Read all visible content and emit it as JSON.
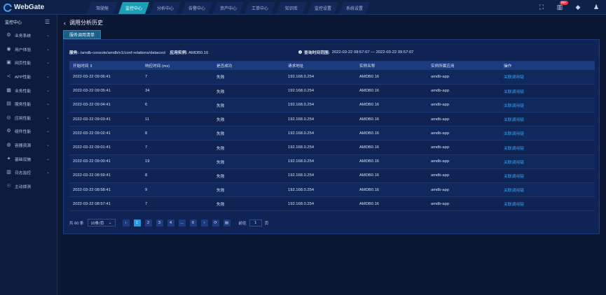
{
  "app": {
    "name": "WebGate"
  },
  "nav": {
    "tabs": [
      {
        "label": "驾驶舱",
        "active": false
      },
      {
        "label": "监控中心",
        "active": true
      },
      {
        "label": "分析中心",
        "active": false
      },
      {
        "label": "告警中心",
        "active": false
      },
      {
        "label": "资产中心",
        "active": false
      },
      {
        "label": "工单中心",
        "active": false
      },
      {
        "label": "知识库",
        "active": false
      },
      {
        "label": "监控设置",
        "active": false
      },
      {
        "label": "系统设置",
        "active": false
      }
    ],
    "notification_badge": "99+"
  },
  "sidebar": {
    "header": "监控中心",
    "items": [
      {
        "label": "业务系统",
        "icon": "gear-icon",
        "has_children": true
      },
      {
        "label": "用户体验",
        "icon": "user-icon",
        "has_children": true
      },
      {
        "label": "网页性能",
        "icon": "monitor-icon",
        "has_children": true
      },
      {
        "label": "APP性能",
        "icon": "share-icon",
        "has_children": true
      },
      {
        "label": "业务性能",
        "icon": "briefcase-icon",
        "has_children": true
      },
      {
        "label": "服务性能",
        "icon": "server-icon",
        "has_children": true
      },
      {
        "label": "应用性能",
        "icon": "app-icon",
        "has_children": true
      },
      {
        "label": "组件性能",
        "icon": "component-icon",
        "has_children": true
      },
      {
        "label": "容器资源",
        "icon": "container-icon",
        "has_children": true
      },
      {
        "label": "基础设施",
        "icon": "infrastructure-icon",
        "has_children": true
      },
      {
        "label": "日志监控",
        "icon": "log-icon",
        "has_children": true
      },
      {
        "label": "主动拨测",
        "icon": "dial-test-icon",
        "has_children": false
      }
    ]
  },
  "page": {
    "title": "调用分析历史",
    "tab": "服务调用清单"
  },
  "info": {
    "service_label": "服务:",
    "service_value": "/amdb-console/amdb/v1/conf-relations/datacool",
    "instance_label": "应用实例:",
    "instance_value": "AMDB0.16",
    "range_label": "查询时间范围:",
    "range_value": "2022-03-22 08:57:07 — 2022-03-22 09:57:07"
  },
  "table": {
    "headers": [
      "开始时间",
      "响应时间 (ms)",
      "是否成功",
      "请求地址",
      "实例名称",
      "实例所属应用",
      "操作"
    ],
    "rows": [
      [
        "2022-03-22 09:06:41",
        "7",
        "失败",
        "192.168.0.254",
        "AMDB0.16",
        "amdb-app",
        "关联调用链"
      ],
      [
        "2022-03-22 09:05:41",
        "34",
        "失败",
        "192.168.0.254",
        "AMDB0.16",
        "amdb-app",
        "关联调用链"
      ],
      [
        "2022-03-22 09:04:41",
        "6",
        "失败",
        "192.168.0.254",
        "AMDB0.16",
        "amdb-app",
        "关联调用链"
      ],
      [
        "2022-03-22 09:03:41",
        "11",
        "失败",
        "192.168.0.254",
        "AMDB0.16",
        "amdb-app",
        "关联调用链"
      ],
      [
        "2022-03-22 09:02:41",
        "8",
        "失败",
        "192.168.0.254",
        "AMDB0.16",
        "amdb-app",
        "关联调用链"
      ],
      [
        "2022-03-22 09:01:41",
        "7",
        "失败",
        "192.168.0.254",
        "AMDB0.16",
        "amdb-app",
        "关联调用链"
      ],
      [
        "2022-03-22 09:00:41",
        "19",
        "失败",
        "192.168.0.254",
        "AMDB0.16",
        "amdb-app",
        "关联调用链"
      ],
      [
        "2022-03-22 08:59:41",
        "8",
        "失败",
        "192.168.0.254",
        "AMDB0.16",
        "amdb-app",
        "关联调用链"
      ],
      [
        "2022-03-22 08:58:41",
        "9",
        "失败",
        "192.168.0.254",
        "AMDB0.16",
        "amdb-app",
        "关联调用链"
      ],
      [
        "2022-03-22 08:57:41",
        "7",
        "失败",
        "192.168.0.254",
        "AMDB0.16",
        "amdb-app",
        "关联调用链"
      ]
    ]
  },
  "pagination": {
    "total": "共 60 条",
    "page_size": "10条/页",
    "pages": [
      "1",
      "2",
      "3",
      "4",
      "...",
      "6"
    ],
    "current": "1",
    "goto_label": "前往",
    "goto_value": "1",
    "goto_suffix": "页"
  },
  "colors": {
    "accent": "#17a0b8",
    "link": "#2fa6ff",
    "background": "#0b1733",
    "panel": "#0f2454"
  }
}
